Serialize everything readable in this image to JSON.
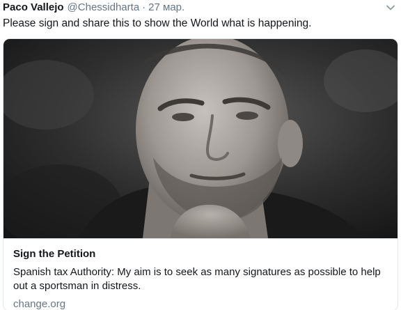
{
  "tweet": {
    "author_name": "Paco Vallejo",
    "author_handle": "@Chessidharta",
    "separator": "·",
    "timestamp": "27 мар.",
    "text": "Please sign and share this to show the World what is happening."
  },
  "card": {
    "image_alt": "Portrait photo of a man resting his chin on his hand",
    "title": "Sign the Petition",
    "description": "Spanish tax Authority: My aim is to seek as many signatures as possible to help out a sportsman in distress.",
    "domain": "change.org"
  },
  "icons": {
    "more_menu": "chevron-down-icon"
  },
  "colors": {
    "text_primary": "#14171a",
    "text_secondary": "#657786",
    "card_border": "#e1e8ed"
  }
}
